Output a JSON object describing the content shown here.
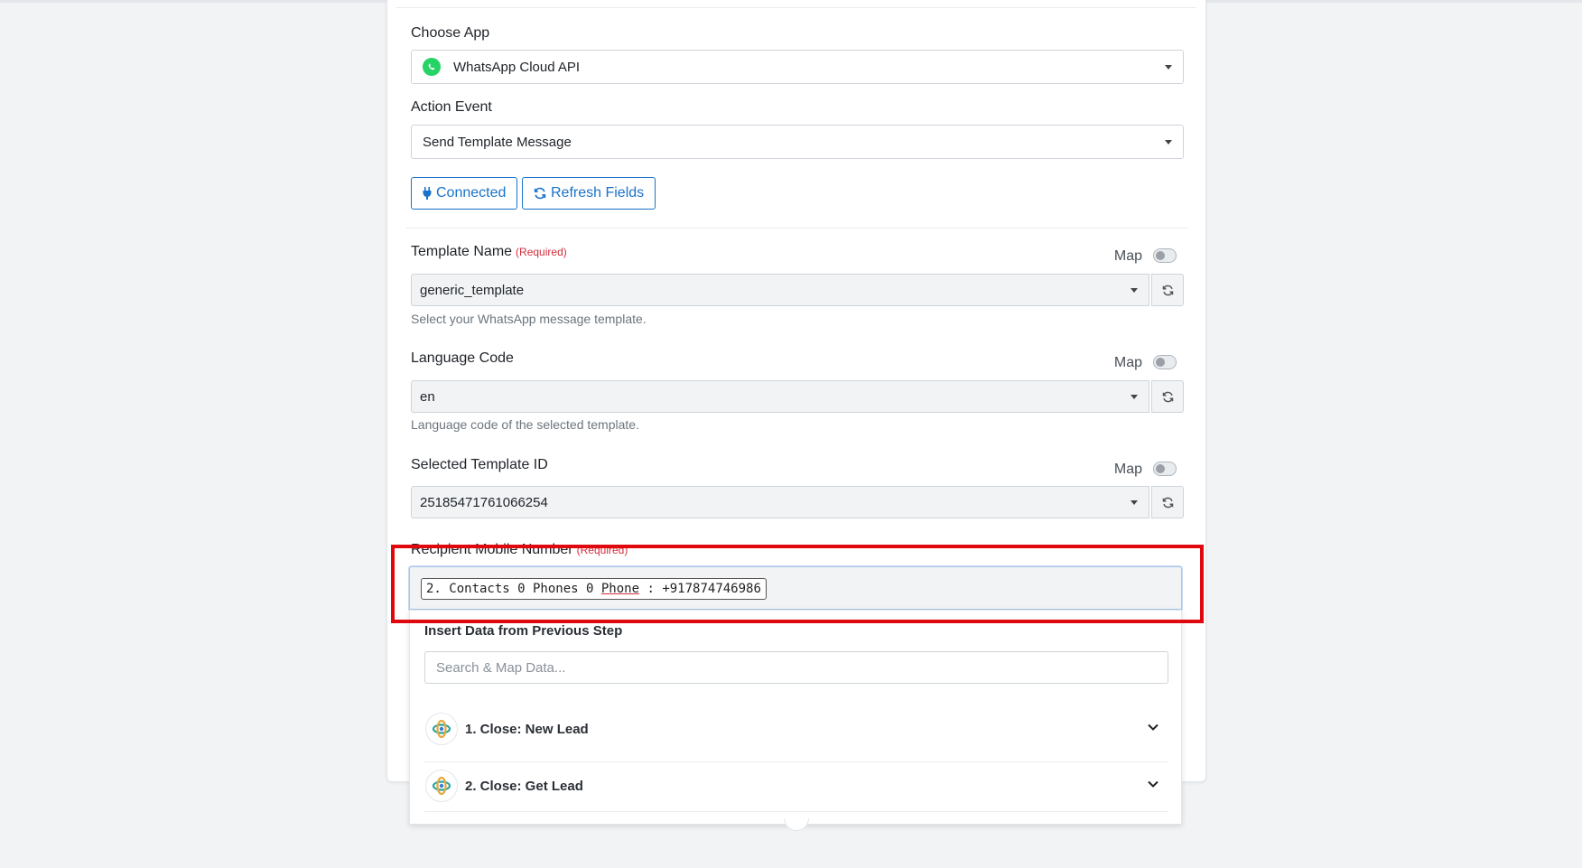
{
  "choose_app": {
    "label": "Choose App",
    "value": "WhatsApp Cloud API",
    "icon": "whatsapp-icon"
  },
  "action_event": {
    "label": "Action Event",
    "value": "Send Template Message"
  },
  "buttons": {
    "connected": "Connected",
    "refresh_fields": "Refresh Fields"
  },
  "template_name": {
    "label": "Template Name",
    "required": "(Required)",
    "map_label": "Map",
    "value": "generic_template",
    "hint": "Select your WhatsApp message template."
  },
  "language_code": {
    "label": "Language Code",
    "map_label": "Map",
    "value": "en",
    "hint": "Language code of the selected template."
  },
  "template_id": {
    "label": "Selected Template ID",
    "map_label": "Map",
    "value": "25185471761066254"
  },
  "recipient": {
    "label": "Recipient Mobile Number",
    "required": "(Required)",
    "chip_prefix": "2. Contacts 0 Phones 0 ",
    "chip_underlined": "Phone",
    "chip_suffix": " : +917874746986"
  },
  "insert_data": {
    "title": "Insert Data from Previous Step",
    "search_placeholder": "Search & Map Data...",
    "steps": [
      {
        "label": "1. Close: New Lead"
      },
      {
        "label": "2. Close: Get Lead"
      }
    ]
  },
  "colors": {
    "accent": "#1a73c9",
    "required": "#d12f3c",
    "highlight": "#e0080d",
    "whatsapp": "#25d366"
  }
}
